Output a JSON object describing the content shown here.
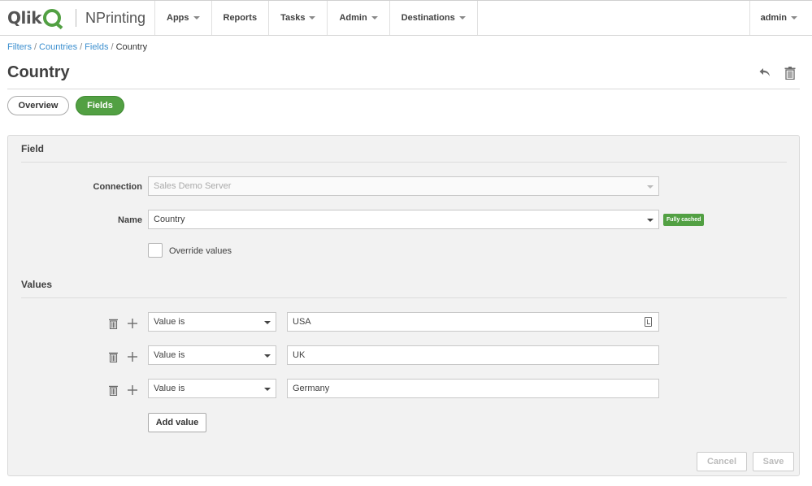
{
  "brand": {
    "logo": "Qlik",
    "product": "NPrinting",
    "accent": "#52a043"
  },
  "nav": {
    "items": [
      {
        "label": "Apps",
        "dropdown": true
      },
      {
        "label": "Reports",
        "dropdown": false
      },
      {
        "label": "Tasks",
        "dropdown": true
      },
      {
        "label": "Admin",
        "dropdown": true
      },
      {
        "label": "Destinations",
        "dropdown": true
      }
    ],
    "user": "admin"
  },
  "breadcrumb": {
    "items": [
      "Filters",
      "Countries",
      "Fields"
    ],
    "current": "Country"
  },
  "page": {
    "title": "Country"
  },
  "tabs": {
    "overview": "Overview",
    "fields": "Fields",
    "active": "Fields"
  },
  "field_section": {
    "title": "Field",
    "connection_label": "Connection",
    "connection_value": "Sales Demo Server",
    "name_label": "Name",
    "name_value": "Country",
    "cache_badge": "Fully cached",
    "override_label": "Override values",
    "override_checked": false
  },
  "values_section": {
    "title": "Values",
    "rows": [
      {
        "operator": "Value is",
        "value": "USA"
      },
      {
        "operator": "Value is",
        "value": "UK"
      },
      {
        "operator": "Value is",
        "value": "Germany"
      }
    ],
    "add_value_label": "Add value"
  },
  "actions": {
    "cancel": "Cancel",
    "save": "Save"
  },
  "icons": {
    "undo": "undo-icon",
    "delete": "trash-icon",
    "add": "plus-icon",
    "keyboard": "keyboard-icon"
  }
}
